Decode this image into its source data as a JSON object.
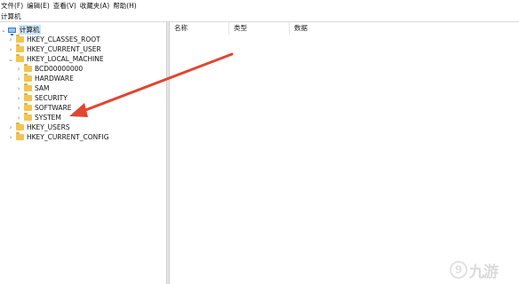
{
  "menu": [
    "文件(F)",
    "编辑(E)",
    "查看(V)",
    "收藏夹(A)",
    "帮助(H)"
  ],
  "address": "计算机",
  "tree": {
    "root": "计算机",
    "nodes": [
      {
        "label": "HKEY_CLASSES_ROOT"
      },
      {
        "label": "HKEY_CURRENT_USER"
      },
      {
        "label": "HKEY_LOCAL_MACHINE"
      },
      {
        "label": "BCD00000000"
      },
      {
        "label": "HARDWARE"
      },
      {
        "label": "SAM"
      },
      {
        "label": "SECURITY"
      },
      {
        "label": "SOFTWARE"
      },
      {
        "label": "SYSTEM"
      },
      {
        "label": "HKEY_USERS"
      },
      {
        "label": "HKEY_CURRENT_CONFIG"
      }
    ]
  },
  "columns": [
    "名称",
    "类型",
    "数据"
  ],
  "watermark": {
    "icon_glyph": "9",
    "text": "九游"
  },
  "colors": {
    "annotation_arrow": "#e0462f",
    "selection": "#cce4f7",
    "folder": "#f1c553"
  }
}
